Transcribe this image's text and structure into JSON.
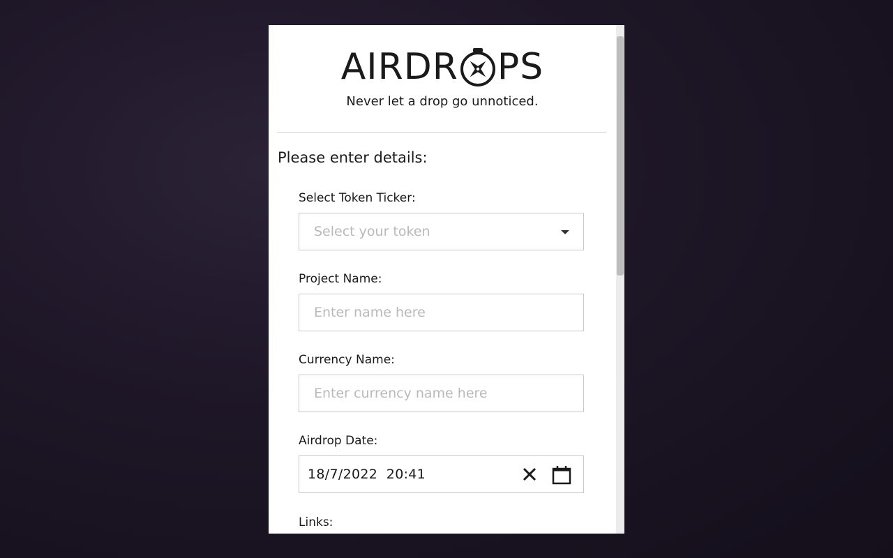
{
  "header": {
    "logo_prefix": "AIRDR",
    "logo_suffix": "PS",
    "tagline": "Never let a drop go unnoticed."
  },
  "form": {
    "title": "Please enter details:",
    "token": {
      "label": "Select Token Ticker:",
      "placeholder": "Select your token"
    },
    "project": {
      "label": "Project Name:",
      "placeholder": "Enter name here"
    },
    "currency": {
      "label": "Currency Name:",
      "placeholder": "Enter currency name here"
    },
    "date": {
      "label": "Airdrop Date:",
      "value": "18/7/2022  20:41"
    },
    "links": {
      "label": "Links:"
    }
  },
  "icons": {
    "logo": "compass-icon",
    "dropdown": "chevron-down-icon",
    "clear": "close-icon",
    "calendar": "calendar-icon"
  }
}
